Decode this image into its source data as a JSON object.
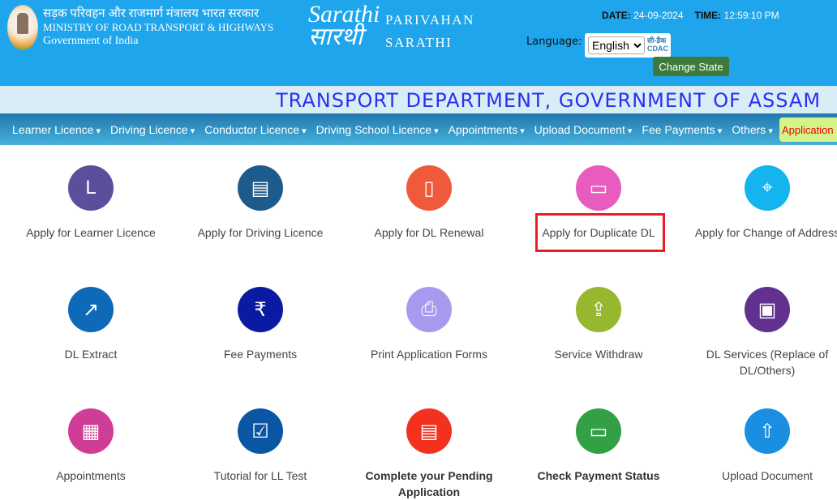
{
  "header": {
    "ministry_hindi": "सड़क परिवहन और राजमार्ग मंत्रालय भारत सरकार",
    "ministry": "MINISTRY OF ROAD TRANSPORT & HIGHWAYS",
    "government": "Government of India",
    "logo_text": "Sarathi सारथी",
    "portal_line1": "PARIVAHAN",
    "portal_line2": "SARATHI",
    "date_label": "DATE:",
    "date": "24-09-2024",
    "time_label": "TIME:",
    "time": "12:59:10 PM",
    "language_label": "Language:",
    "language_value": "English",
    "cdac": "सी-डैक CDAC",
    "change_state": "Change State"
  },
  "banner": "TRANSPORT DEPARTMENT, GOVERNMENT OF ASSAM",
  "nav": [
    "Learner Licence",
    "Driving Licence",
    "Conductor Licence",
    "Driving School Licence",
    "Appointments",
    "Upload Document",
    "Fee Payments",
    "Others"
  ],
  "nav_application": "Application",
  "tiles": [
    {
      "label": "Apply for Learner Licence",
      "color": "#5b4f9c",
      "icon": "L"
    },
    {
      "label": "Apply for Driving Licence",
      "color": "#1d5b8c",
      "icon": "▤"
    },
    {
      "label": "Apply for DL Renewal",
      "color": "#f05a3a",
      "icon": "▯"
    },
    {
      "label": "Apply for Duplicate DL",
      "color": "#e85bbf",
      "icon": "▭",
      "highlighted": true
    },
    {
      "label": "Apply for Change of Address",
      "color": "#14b4ee",
      "icon": "⌖"
    },
    {
      "label": "DL Extract",
      "color": "#0e69b8",
      "icon": "↗"
    },
    {
      "label": "Fee Payments",
      "color": "#0a1aa3",
      "icon": "₹"
    },
    {
      "label": "Print Application Forms",
      "color": "#a79bf0",
      "icon": "⎙"
    },
    {
      "label": "Service Withdraw",
      "color": "#96b72e",
      "icon": "⇪"
    },
    {
      "label": "DL Services (Replace of DL/Others)",
      "color": "#62308f",
      "icon": "▣"
    },
    {
      "label": "Appointments",
      "color": "#d03d96",
      "icon": "▦"
    },
    {
      "label": "Tutorial for LL Test",
      "color": "#0a56a5",
      "icon": "☑"
    },
    {
      "label": "Complete your Pending Application",
      "color": "#f2321f",
      "icon": "▤",
      "bold": true
    },
    {
      "label": "Check Payment Status",
      "color": "#33a046",
      "icon": "▭",
      "bold": true
    },
    {
      "label": "Upload Document",
      "color": "#1a8ee0",
      "icon": "⇧"
    }
  ]
}
